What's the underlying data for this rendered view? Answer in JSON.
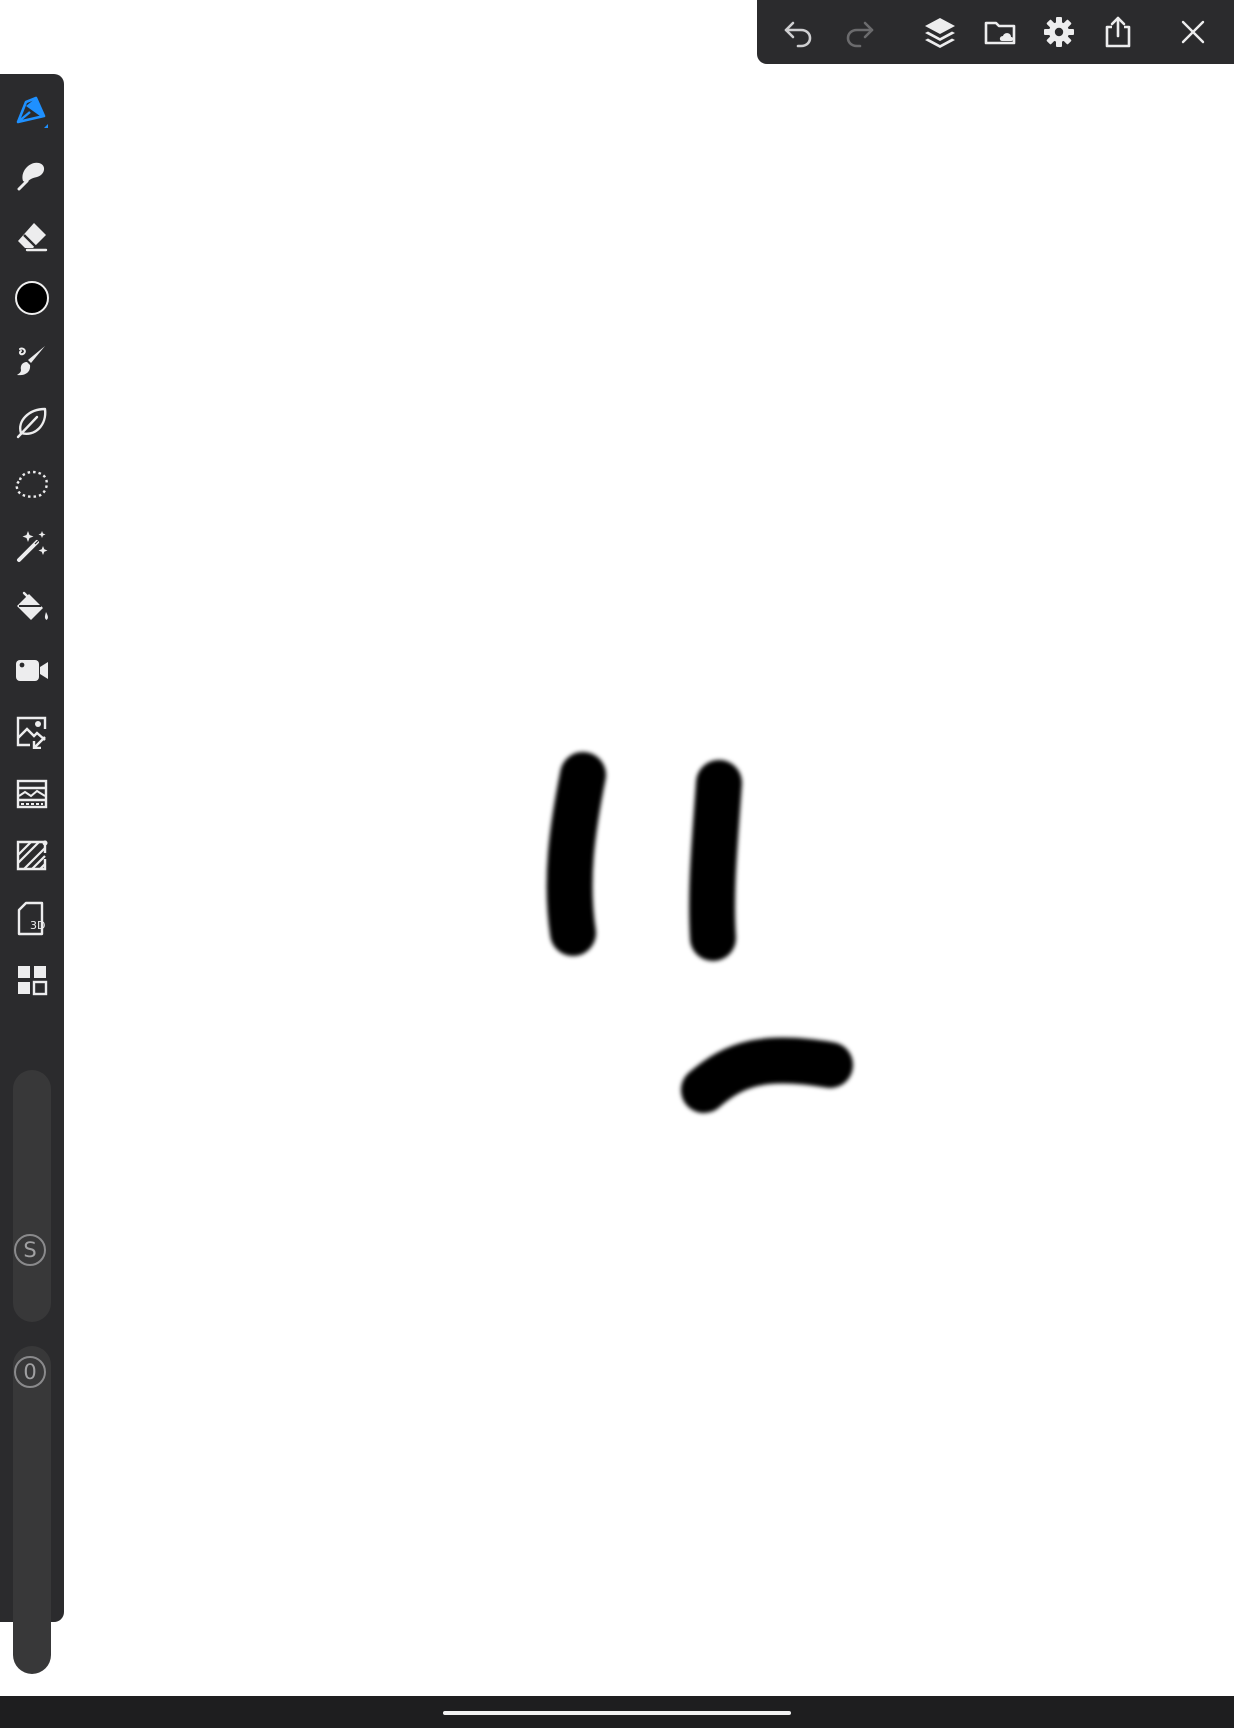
{
  "app": {
    "accent_color": "#1e90ff",
    "toolbar_color": "#2b2b2d"
  },
  "top_toolbar": {
    "buttons": [
      {
        "icon": "undo-icon",
        "state": "enabled"
      },
      {
        "icon": "redo-icon",
        "state": "disabled"
      },
      {
        "icon": "layers-icon"
      },
      {
        "icon": "gallery-folder-icon"
      },
      {
        "icon": "gear-icon"
      },
      {
        "icon": "share-icon"
      },
      {
        "icon": "close-icon"
      }
    ]
  },
  "left_toolbar": {
    "tools": [
      {
        "icon": "pen-tool-icon",
        "selected": true
      },
      {
        "icon": "smudge-icon"
      },
      {
        "icon": "eraser-icon"
      },
      {
        "icon": "color-swatch-icon",
        "color": "#000000"
      },
      {
        "icon": "brush-library-icon"
      },
      {
        "icon": "leaf-stabilizer-icon"
      },
      {
        "icon": "lasso-selection-icon"
      },
      {
        "icon": "magic-wand-icon"
      },
      {
        "icon": "paint-bucket-icon"
      },
      {
        "icon": "video-record-icon"
      },
      {
        "icon": "image-import-icon"
      },
      {
        "icon": "filter-icon"
      },
      {
        "icon": "texture-icon"
      },
      {
        "icon": "3d-model-icon",
        "badge": "3D"
      },
      {
        "icon": "more-tools-icon"
      }
    ],
    "size_slider": {
      "label": "S"
    },
    "opacity_slider": {
      "label": "0"
    }
  },
  "canvas": {
    "background": "#ffffff",
    "strokes": [
      {
        "shape": "left-eye-line",
        "color": "#000000"
      },
      {
        "shape": "right-eye-line",
        "color": "#000000"
      },
      {
        "shape": "frown-mouth",
        "color": "#000000"
      }
    ]
  }
}
